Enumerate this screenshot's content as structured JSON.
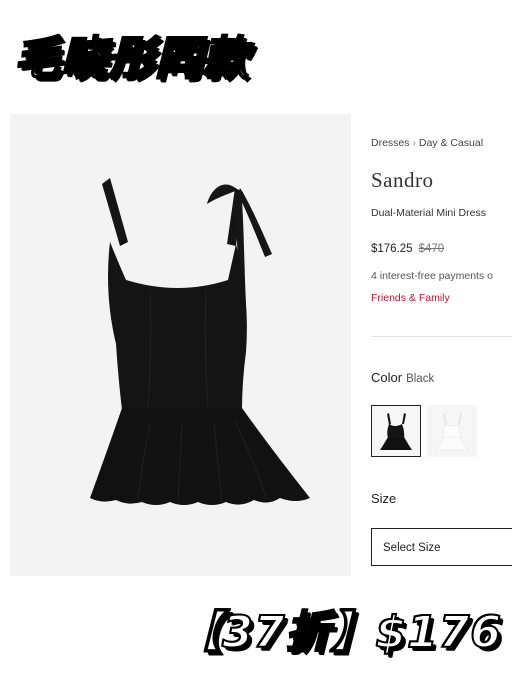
{
  "overlay": {
    "title": "毛晓彤同款",
    "price_tag": "【37折】$176"
  },
  "product": {
    "breadcrumb": [
      "Dresses",
      "Day & Casual"
    ],
    "brand": "Sandro",
    "name": "Dual-Material Mini Dress",
    "price_current": "$176.25",
    "price_original": "$470",
    "payments_text": "4 interest-free payments o",
    "promo_text": "Friends & Family",
    "color_label": "Color",
    "color_value": "Black",
    "size_label": "Size",
    "size_select_placeholder": "Select Size"
  },
  "icons": {
    "breadcrumb_separator": "chevron-right-icon"
  },
  "colors": {
    "promo": "#c8102e",
    "dress": "#141414",
    "panel_bg": "#f3f3f3"
  }
}
